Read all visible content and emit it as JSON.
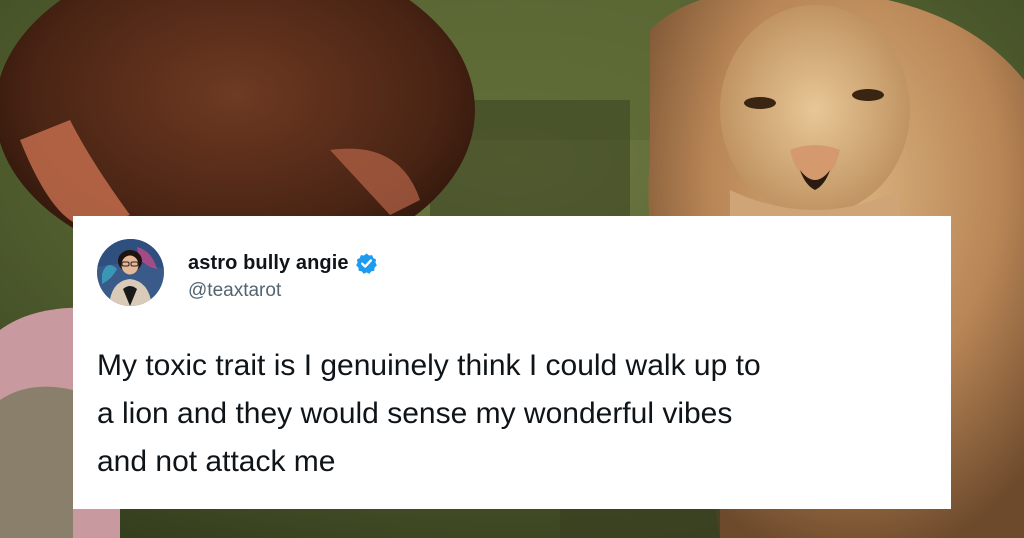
{
  "tweet": {
    "display_name": "astro bully angie",
    "handle": "@teaxtarot",
    "text": "My toxic trait is I genuinely think I could walk up to\na lion and they would sense my wonderful vibes\nand not attack me",
    "verified": true,
    "badge_color": "#1d9bf0"
  },
  "background": {
    "description_icons": [
      "person-back-of-head",
      "lion"
    ]
  }
}
